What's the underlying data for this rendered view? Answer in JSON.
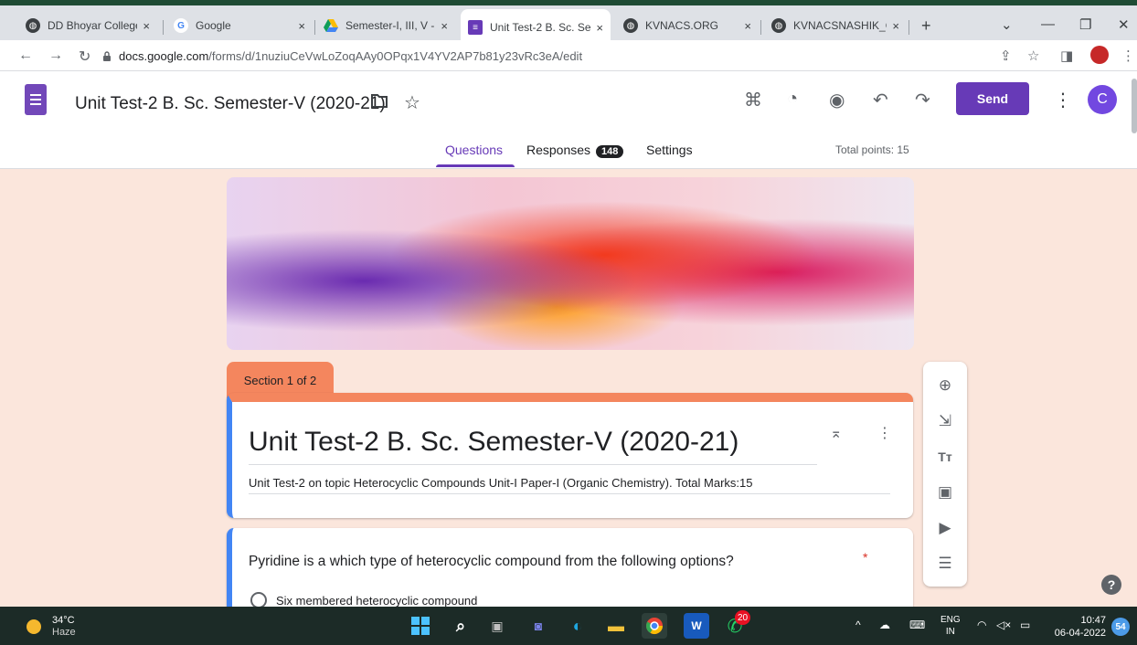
{
  "browser": {
    "tabs": [
      {
        "label": "DD Bhoyar College",
        "favicon": "globe-icon",
        "close": "×"
      },
      {
        "label": "Google",
        "favicon": "google-icon",
        "close": "×"
      },
      {
        "label": "Semester-I, III, V - (",
        "favicon": "drive-icon",
        "close": "×"
      },
      {
        "label": "Unit Test-2 B. Sc. Se",
        "favicon": "forms-icon",
        "close": "×"
      },
      {
        "label": "KVNACS.ORG",
        "favicon": "globe-icon",
        "close": "×"
      },
      {
        "label": "KVNACSNASHIK_C",
        "favicon": "globe-icon",
        "close": "×"
      }
    ],
    "new_tab": "+",
    "url_host": "docs.google.com",
    "url_path": "/forms/d/1nuziuCeVwLoZoqAAy0OPqx1V4YV2AP7b81y23vRc3eA/edit"
  },
  "forms_header": {
    "doc_title": "Unit Test-2 B. Sc. Semester-V (2020-21)",
    "send_label": "Send",
    "avatar_letter": "C",
    "tabs": {
      "questions": "Questions",
      "responses": "Responses",
      "settings": "Settings"
    },
    "responses_count": "148",
    "total_points": "Total points: 15",
    "accent_color": "#673ab7"
  },
  "form": {
    "section_label": "Section 1 of 2",
    "title": "Unit Test-2 B. Sc. Semester-V (2020-21)",
    "description": "Unit Test-2 on topic Heterocyclic Compounds Unit-I Paper-I (Organic Chemistry). Total Marks:15",
    "question": {
      "text": "Pyridine is a which type of heterocyclic compound from the following options?",
      "required_mark": "*",
      "option_1": "Six membered heterocyclic compound"
    },
    "theme_color": "#f4865e"
  },
  "toolbar_icons": [
    "add-question-icon",
    "import-questions-icon",
    "add-title-icon",
    "add-image-icon",
    "add-video-icon",
    "add-section-icon"
  ],
  "help_label": "?",
  "taskbar": {
    "temperature": "34°C",
    "weather": "Haze",
    "whatsapp_badge": "20",
    "lang_1": "ENG",
    "lang_2": "IN",
    "time": "10:47",
    "date": "06-04-2022",
    "notifications": "54"
  }
}
